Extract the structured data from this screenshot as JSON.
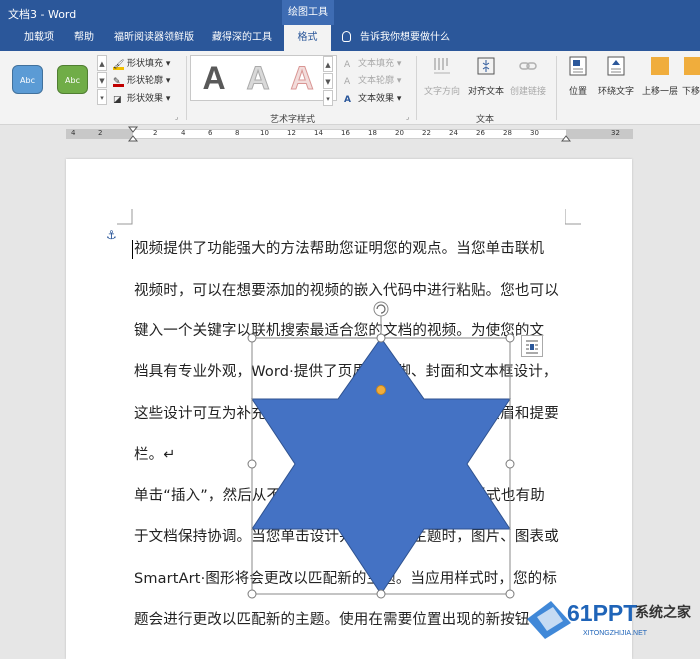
{
  "window": {
    "title": "文档3  -  Word",
    "context_tab_title": "绘图工具"
  },
  "tabs": [
    {
      "label": "加载项"
    },
    {
      "label": "帮助"
    },
    {
      "label": "福昕阅读器领鲜版"
    },
    {
      "label": "藏得深的工具"
    },
    {
      "label": "格式",
      "active": true
    }
  ],
  "tell_me": "告诉我你想要做什么",
  "ribbon": {
    "shape_styles": {
      "abc1": "Abc",
      "abc2": "Abc",
      "fill": "形状填充",
      "outline": "形状轮廓",
      "effects": "形状效果"
    },
    "wordart": {
      "sample": "A",
      "group_label": "艺术字样式",
      "text_fill": "文本填充",
      "text_outline": "文本轮廓",
      "text_effects": "文本效果"
    },
    "text": {
      "direction": "文字方向",
      "align": "对齐文本",
      "link": "创建链接",
      "group_label": "文本"
    },
    "arrange": {
      "position": "位置",
      "wrap": "环绕文字",
      "forward": "上移一层",
      "backward": "下移"
    }
  },
  "ruler": {
    "labels": [
      "4",
      "2",
      "2",
      "4",
      "6",
      "8",
      "10",
      "12",
      "14",
      "16",
      "18",
      "20",
      "22",
      "24",
      "26",
      "28",
      "30",
      "32"
    ]
  },
  "document": {
    "lines": [
      "视频提供了功能强大的方法帮助您证明您的观点。当您单击联机",
      "视频时，可以在想要添加的视频的嵌入代码中进行粘贴。您也可以",
      "键入一个关键字以联机搜索最适合您的文档的视频。为使您的文",
      "档具有专业外观，Word·提供了页眉、页脚、封面和文本框设计，",
      "这些设计可互为补充。例如，您可以添加匹配的封面、页眉和提要",
      "栏。↵",
      "单击“插入”，然后从不同库中选择所需元素。主题和样式也有助",
      "于文档保持协调。当您单击设计并选择新的主题时，图片、图表或",
      "SmartArt·图形将会更改以匹配新的主题。当应用样式时，您的标",
      "题会进行更改以匹配新的主题。使用在需要位置出现的新按钮"
    ]
  },
  "watermark": {
    "brand": "61PPT",
    "sub": "XITONGZHIJIA.NET",
    "cn": "系统之家"
  },
  "colors": {
    "ribbon_blue": "#2b579a",
    "star_fill": "#4472c4",
    "abc1": "#5b9bd5",
    "abc2": "#70ad47",
    "handle_yellow": "#f0ad3c"
  }
}
